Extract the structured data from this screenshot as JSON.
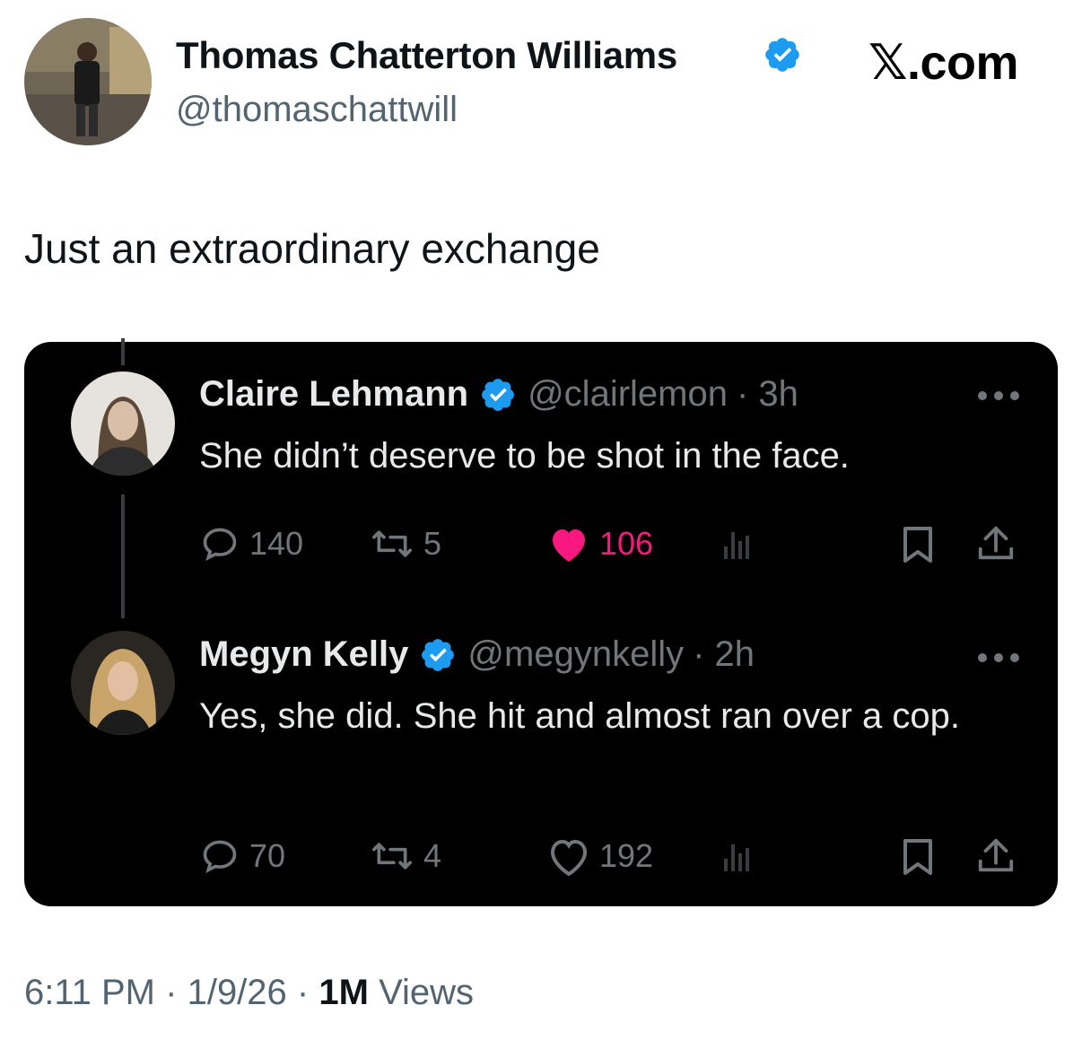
{
  "author": {
    "name": "Thomas Chatterton Williams",
    "handle": "@thomaschattwill",
    "verified": true
  },
  "site_label": "𝕏.com",
  "tweet": {
    "text": "Just an extraordinary exchange",
    "time": "6:11 PM",
    "separator": "·",
    "date": "1/9/26",
    "views_count": "1M",
    "views_label": "Views"
  },
  "replies": [
    {
      "name": "Claire Lehmann",
      "handle": "@clairlemon",
      "time": "· 3h",
      "text": "She didn’t deserve to be shot in the face.",
      "replies_count": "140",
      "retweets_count": "5",
      "likes_count": "106",
      "liked": true
    },
    {
      "name": "Megyn Kelly",
      "handle": "@megynkelly",
      "time": "· 2h",
      "text": "Yes, she did. She hit and almost ran over a cop.",
      "replies_count": "70",
      "retweets_count": "4",
      "likes_count": "192",
      "liked": false
    }
  ],
  "colors": {
    "verified_blue": "#1d9bf0",
    "like_pink": "#f91880",
    "muted_gray": "#71767b",
    "embed_bg": "#000000"
  },
  "icons": [
    "verified-badge-icon",
    "more-options-icon",
    "reply-icon",
    "retweet-icon",
    "like-icon",
    "views-icon",
    "bookmark-icon",
    "share-icon"
  ]
}
